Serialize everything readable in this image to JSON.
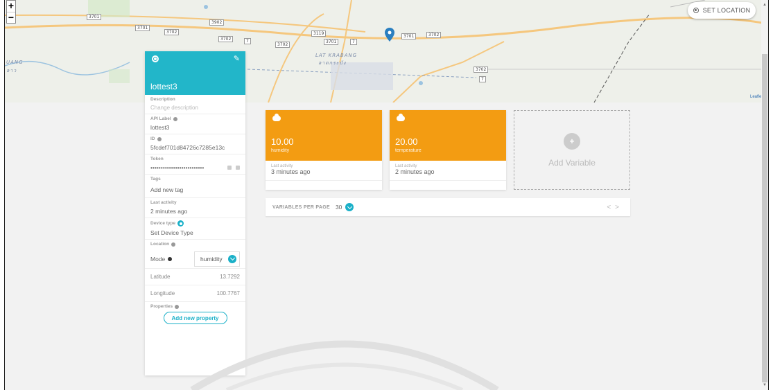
{
  "map": {
    "zoom_in": "+",
    "zoom_out": "−",
    "road_labels": [
      "3701",
      "3701",
      "3702",
      "3902",
      "3702",
      "7",
      "3702",
      "3119",
      "3701",
      "7",
      "3701",
      "3702",
      "3702",
      "7"
    ],
    "area_labels": [
      "UANG",
      "ลาว",
      "LAT KRABANG",
      "ลาดกระบัง"
    ],
    "attribution": "Leaflet",
    "set_location": "SET LOCATION"
  },
  "device": {
    "name": "lottest3",
    "fields": {
      "description_label": "Description",
      "description_placeholder": "Change description",
      "api_label_label": "API Label",
      "api_label_value": "lottest3",
      "id_label": "ID",
      "id_value": "5fcdef701d84726c7285e13c",
      "token_label": "Token",
      "token_value": "••••••••••••••••••••••••••",
      "tags_label": "Tags",
      "tags_placeholder": "Add new tag",
      "last_activity_label": "Last activity",
      "last_activity_value": "2 minutes ago",
      "device_type_label": "Device type",
      "device_type_value": "Set Device Type",
      "location_label": "Location",
      "mode_label": "Mode",
      "mode_value": "humidity",
      "latitude_label": "Latitude",
      "latitude_value": "13.7292",
      "longitude_label": "Longitude",
      "longitude_value": "100.7767",
      "properties_label": "Properties",
      "add_property": "Add new property"
    }
  },
  "variables": [
    {
      "value": "10.00",
      "name": "humidity",
      "last_activity_label": "Last activity",
      "last_activity": "3 minutes ago",
      "color": "#f39c12"
    },
    {
      "value": "20.00",
      "name": "temperature",
      "last_activity_label": "Last activity",
      "last_activity": "2 minutes ago",
      "color": "#f39c12"
    }
  ],
  "add_variable": {
    "plus": "+",
    "label": "Add Variable"
  },
  "pager": {
    "label": "VARIABLES PER PAGE",
    "value": "30",
    "prev": "<",
    "next": ">"
  },
  "colors": {
    "accent": "#1ab0c8",
    "header": "#22b6c9",
    "card": "#f39c12"
  }
}
